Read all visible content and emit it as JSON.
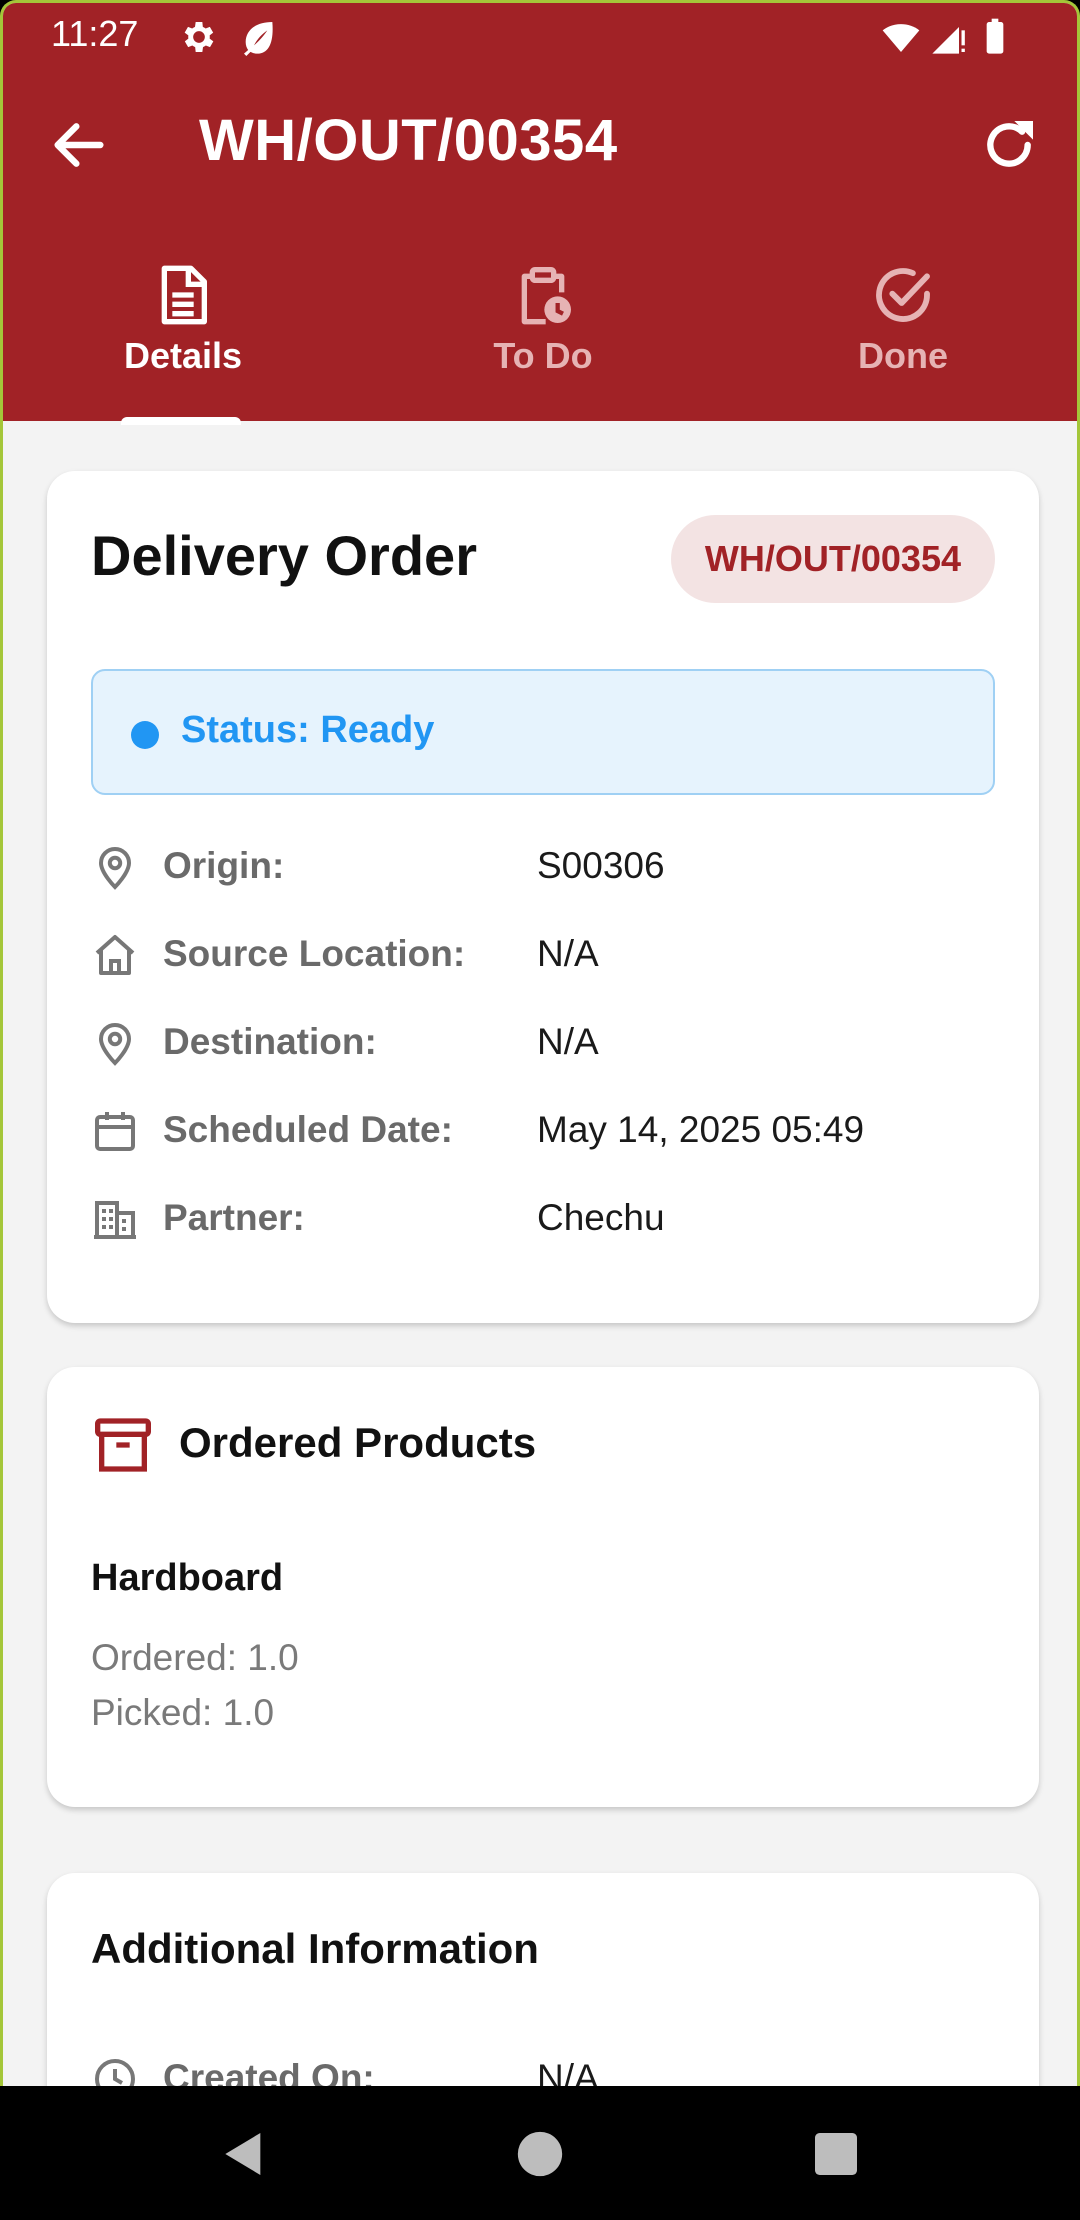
{
  "status_bar": {
    "time": "11:27"
  },
  "header": {
    "title": "WH/OUT/00354"
  },
  "tabs": [
    {
      "label": "Details",
      "icon": "document-icon",
      "selected": true
    },
    {
      "label": "To Do",
      "icon": "clipboard-clock-icon",
      "selected": false
    },
    {
      "label": "Done",
      "icon": "check-circle-icon",
      "selected": false
    }
  ],
  "order": {
    "title": "Delivery Order",
    "reference": "WH/OUT/00354",
    "status": "Status: Ready",
    "fields": [
      {
        "icon": "location-pin-icon",
        "label": "Origin:",
        "value": "S00306"
      },
      {
        "icon": "home-icon",
        "label": "Source Location:",
        "value": "N/A"
      },
      {
        "icon": "location-pin-icon",
        "label": "Destination:",
        "value": "N/A"
      },
      {
        "icon": "calendar-icon",
        "label": "Scheduled Date:",
        "value": "May 14, 2025 05:49"
      },
      {
        "icon": "building-icon",
        "label": "Partner:",
        "value": "Chechu"
      }
    ]
  },
  "products": {
    "title": "Ordered Products",
    "items": [
      {
        "name": "Hardboard",
        "ordered": "Ordered: 1.0",
        "picked": "Picked: 1.0"
      }
    ]
  },
  "additional": {
    "title": "Additional Information",
    "fields": [
      {
        "icon": "clock-icon",
        "label": "Created On:",
        "value": "N/A"
      }
    ]
  },
  "colors": {
    "primary": "#a12226",
    "status": "#2196f3",
    "background": "#f3f3f3"
  }
}
